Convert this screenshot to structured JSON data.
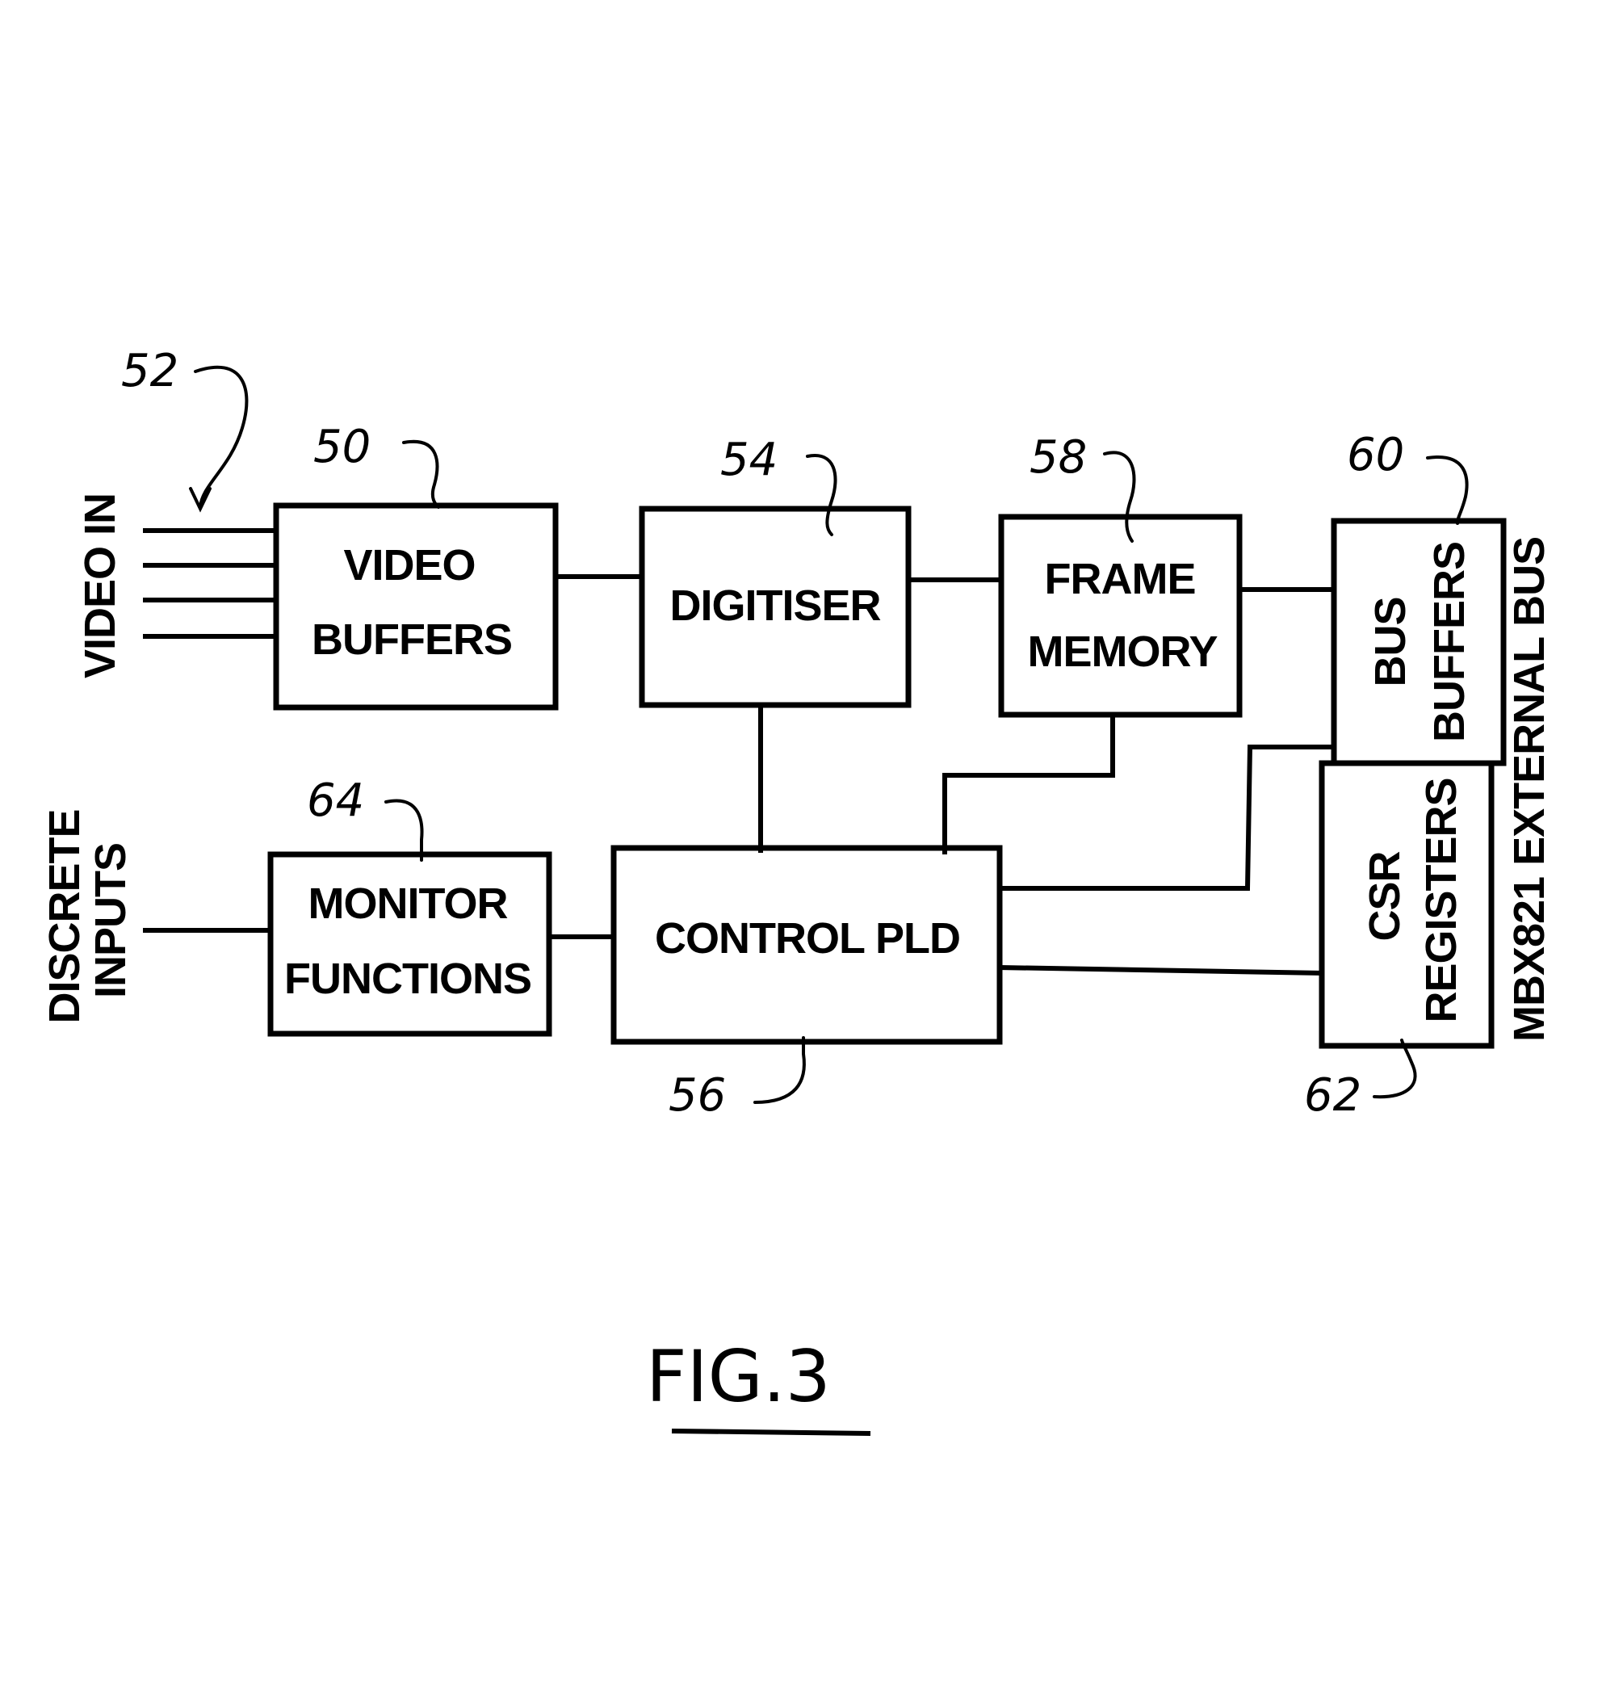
{
  "figure": {
    "caption": "FIG.3"
  },
  "blocks": {
    "video_buffers": {
      "ref": "50",
      "line1": "VIDEO",
      "line2": "BUFFERS"
    },
    "digitiser": {
      "ref": "54",
      "line1": "DIGITISER"
    },
    "frame_memory": {
      "ref": "58",
      "line1": "FRAME",
      "line2": "MEMORY"
    },
    "bus_buffers": {
      "ref": "60",
      "line1": "BUS",
      "line2": "BUFFERS"
    },
    "csr_registers": {
      "ref": "62",
      "line1": "CSR",
      "line2": "REGISTERS"
    },
    "monitor_functions": {
      "ref": "64",
      "line1": "MONITOR",
      "line2": "FUNCTIONS"
    },
    "control_pld": {
      "ref": "56",
      "line1": "CONTROL PLD"
    }
  },
  "inputs": {
    "video_in": {
      "ref": "52",
      "label": "VIDEO IN",
      "line_count": 4
    },
    "discrete_inputs": {
      "line1": "DISCRETE",
      "line2": "INPUTS"
    }
  },
  "external_bus": {
    "label": "MBX821 EXTERNAL BUS"
  }
}
